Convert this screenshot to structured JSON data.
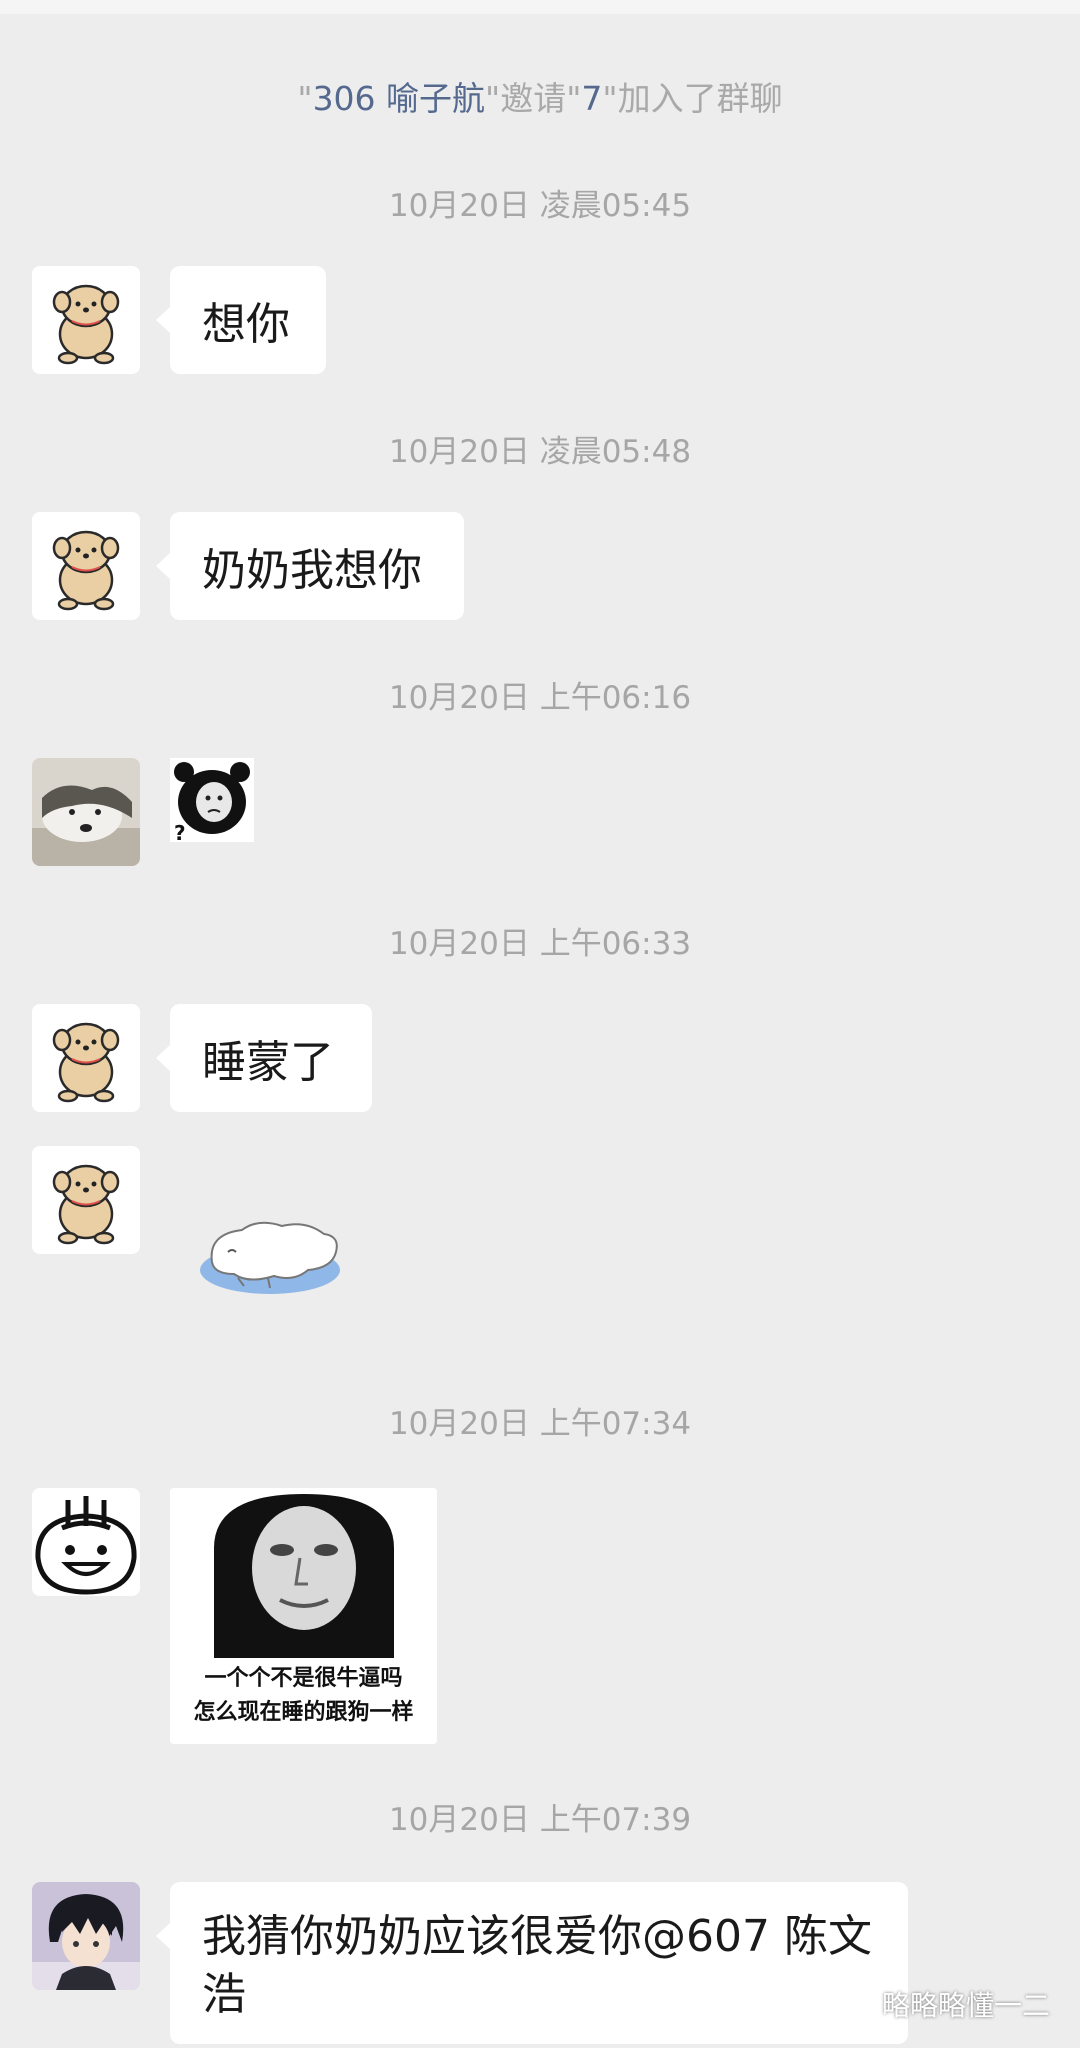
{
  "system_notice": {
    "inviter": "306 喻子航",
    "action": "邀请",
    "invitee": "7",
    "suffix": "加入了群聊"
  },
  "messages": [
    {
      "timestamp": "10月20日 凌晨05:45",
      "sender_avatar": "cartoon-dog-avatar",
      "type": "text",
      "text": "想你"
    },
    {
      "timestamp": "10月20日 凌晨05:48",
      "sender_avatar": "cartoon-dog-avatar",
      "type": "text",
      "text": "奶奶我想你"
    },
    {
      "timestamp": "10月20日 上午06:16",
      "sender_avatar": "husky-photo-avatar",
      "type": "sticker",
      "sticker": "panda-head-question-sticker"
    },
    {
      "timestamp": "10月20日 上午06:33",
      "sender_avatar": "cartoon-dog-avatar",
      "type": "text",
      "text": "睡蒙了"
    },
    {
      "timestamp": "",
      "sender_avatar": "cartoon-dog-avatar",
      "type": "sticker",
      "sticker": "sleeping-white-dog-sticker"
    },
    {
      "timestamp": "10月20日 上午07:34",
      "sender_avatar": "doodle-face-avatar",
      "type": "image",
      "caption_line1": "一个个不是很牛逼吗",
      "caption_line2": "怎么现在睡的跟狗一样"
    },
    {
      "timestamp": "10月20日 上午07:39",
      "sender_avatar": "anime-boy-avatar",
      "type": "text",
      "line1": "我猜你奶奶应该很爱你@607 陈文",
      "line2": "浩"
    }
  ],
  "watermark": {
    "text": "略略略懂一二",
    "icon": "wechat-icon"
  }
}
